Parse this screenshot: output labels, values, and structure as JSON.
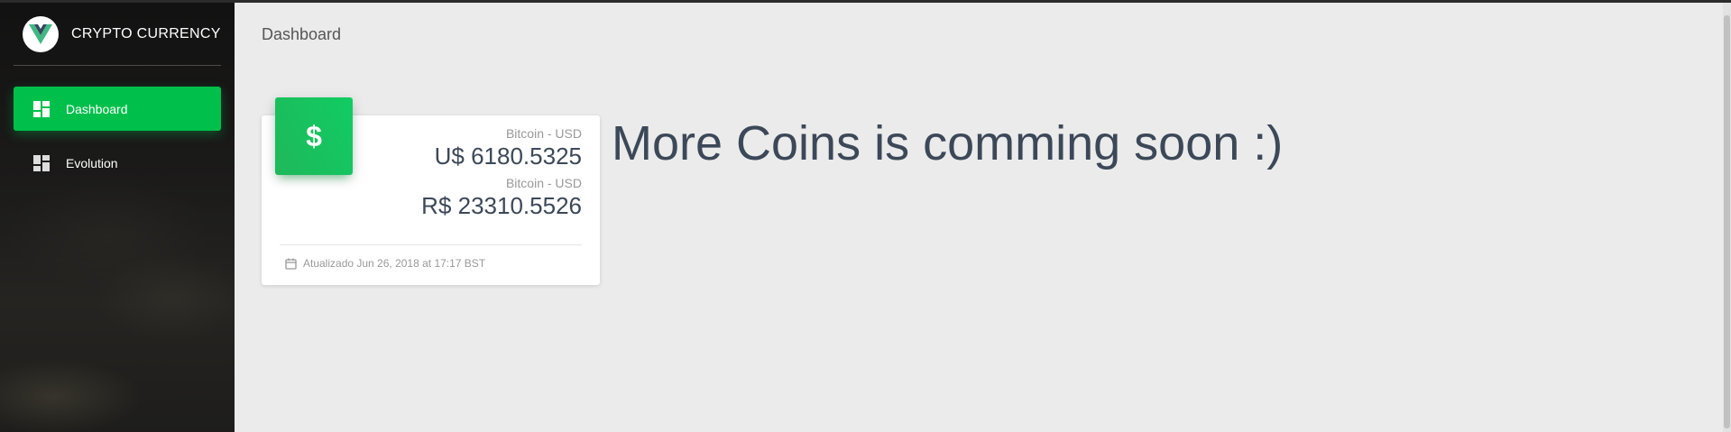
{
  "brand": {
    "title": "CRYPTO CURRENCY",
    "logo_icon": "vue-logo-icon"
  },
  "sidebar": {
    "items": [
      {
        "label": "Dashboard",
        "icon": "dashboard-icon",
        "active": true
      },
      {
        "label": "Evolution",
        "icon": "dashboard-icon",
        "active": false
      }
    ]
  },
  "header": {
    "title": "Dashboard"
  },
  "card": {
    "icon": "$",
    "rows": [
      {
        "category": "Bitcoin - USD",
        "value": "U$ 6180.5325"
      },
      {
        "category": "Bitcoin - USD",
        "value": "R$ 23310.5526"
      }
    ],
    "footer": "Atualizado Jun 26, 2018 at 17:17 BST",
    "footer_icon": "calendar-icon"
  },
  "message": "More Coins is comming soon :)",
  "colors": {
    "accent": "#00c04b",
    "background": "#ebebeb",
    "text": "#3c4858"
  }
}
